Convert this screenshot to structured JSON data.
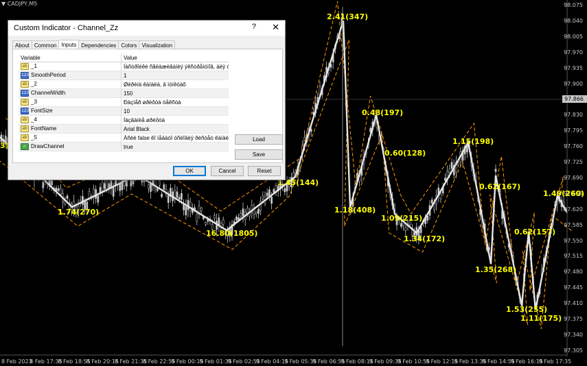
{
  "chart": {
    "symbol": "CADJPY,M5",
    "current_price": "97.866",
    "price_axis": [
      "98.075",
      "98.040",
      "98.005",
      "97.970",
      "97.935",
      "97.900",
      "97.865",
      "97.830",
      "97.795",
      "97.760",
      "97.725",
      "97.690",
      "97.655",
      "97.620",
      "97.585",
      "97.550",
      "97.515",
      "97.480",
      "97.445",
      "97.410",
      "97.375",
      "97.340",
      "97.305"
    ],
    "time_axis": [
      "8 Feb 2023",
      "8 Feb 17:35",
      "8 Feb 18:55",
      "8 Feb 20:15",
      "8 Feb 21:35",
      "8 Feb 22:55",
      "9 Feb 00:15",
      "9 Feb 01:35",
      "9 Feb 02:55",
      "9 Feb 04:15",
      "9 Feb 05:35",
      "9 Feb 06:55",
      "9 Feb 08:15",
      "9 Feb 09:35",
      "9 Feb 10:55",
      "9 Feb 12:15",
      "9 Feb 13:35",
      "9 Feb 14:55",
      "9 Feb 16:15",
      "9 Feb 17:35"
    ],
    "zigzag_labels": [
      "3)",
      "1.74(270)",
      "16.80(1805)",
      "1.45(144)",
      "2.41(347)",
      "1.18(408)",
      "0.48(197)",
      "0.60(128)",
      "1.09(215)",
      "1.34(172)",
      "1.15(198)",
      "0.62(167)",
      "1.35(268)",
      "1.53(255)",
      "0.62(157)",
      "1.11(175)",
      "1.49(260)"
    ],
    "colors": {
      "background": "#000000",
      "candle": "#c8c8c8",
      "zigzag": "#e6e6e6",
      "channel": "#ff9900",
      "label": "#ffff00"
    }
  },
  "dialog": {
    "title": "Custom Indicator - Channel_Zz",
    "help": "?",
    "close": "✕",
    "tabs": [
      "About",
      "Common",
      "Inputs",
      "Dependencies",
      "Colors",
      "Visualization"
    ],
    "active_tab": "Inputs",
    "columns": {
      "variable": "Variable",
      "value": "Value"
    },
    "params": [
      {
        "icon": "ab",
        "variable": "_1",
        "value": "Íàñòðîéêè ñãëàæèâàíèÿ ýêñòðåìóìîâ, äëÿ óëèó..."
      },
      {
        "icon": "num",
        "variable": "SmoothPeriod",
        "value": "1"
      },
      {
        "icon": "ab",
        "variable": "_2",
        "value": "Øèðèíà êàíàëà, â ïóíêòàõ"
      },
      {
        "icon": "num",
        "variable": "ChannelWidth",
        "value": "150"
      },
      {
        "icon": "ab",
        "variable": "_3",
        "value": "Ðàçìåð øðèôòà òåêñòà"
      },
      {
        "icon": "num",
        "variable": "FontSize",
        "value": "10"
      },
      {
        "icon": "ab",
        "variable": "_4",
        "value": "Íàçâàíèå øðèôòà"
      },
      {
        "icon": "ab",
        "variable": "FontName",
        "value": "Arial Black"
      },
      {
        "icon": "ab",
        "variable": "_5",
        "value": "Áñëè false êî ìåäàòî óñëîâèÿ ðèñóåò êàíàë..."
      },
      {
        "icon": "bool",
        "variable": "DrawChannel",
        "value": "true"
      }
    ],
    "buttons": {
      "load": "Load",
      "save": "Save",
      "ok": "OK",
      "cancel": "Cancel",
      "reset": "Reset"
    }
  }
}
